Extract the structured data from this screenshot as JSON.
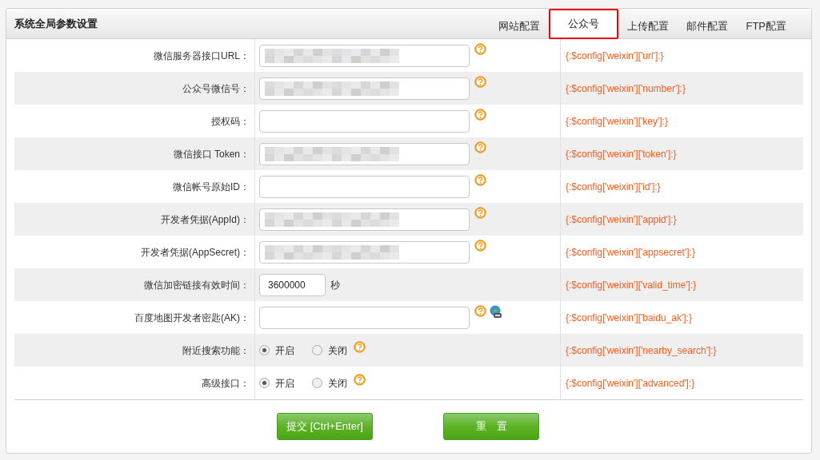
{
  "panel": {
    "title": "系统全局参数设置"
  },
  "tabs": [
    {
      "label": "网站配置",
      "selected": false
    },
    {
      "label": "公众号",
      "selected": true
    },
    {
      "label": "上传配置",
      "selected": false
    },
    {
      "label": "邮件配置",
      "selected": false
    },
    {
      "label": "FTP配置",
      "selected": false
    }
  ],
  "rows": [
    {
      "kind": "text",
      "label": "微信服务器接口URL：",
      "redacted": true,
      "help": true,
      "code": "{:$config['weixin']['url']:}"
    },
    {
      "kind": "text",
      "label": "公众号微信号：",
      "redacted": true,
      "help": true,
      "code": "{:$config['weixin']['number']:}"
    },
    {
      "kind": "text",
      "label": "授权码：",
      "redacted": false,
      "help": true,
      "code": "{:$config['weixin']['key']:}"
    },
    {
      "kind": "text",
      "label": "微信接口 Token：",
      "redacted": true,
      "help": true,
      "code": "{:$config['weixin']['token']:}"
    },
    {
      "kind": "text",
      "label": "微信帐号原始ID：",
      "redacted": false,
      "help": true,
      "code": "{:$config['weixin']['id']:}"
    },
    {
      "kind": "text",
      "label": "开发者凭据(AppId)：",
      "redacted": true,
      "help": true,
      "code": "{:$config['weixin']['appid']:}"
    },
    {
      "kind": "text",
      "label": "开发者凭据(AppSecret)：",
      "redacted": true,
      "help": true,
      "code": "{:$config['weixin']['appsecret']:}"
    },
    {
      "kind": "short",
      "label": "微信加密链接有效时间：",
      "value": "3600000",
      "unit": "秒",
      "code": "{:$config['weixin']['valid_time']:}"
    },
    {
      "kind": "text",
      "label": "百度地图开发者密匙(AK)：",
      "redacted": false,
      "help": true,
      "map_link": true,
      "code": "{:$config['weixin']['baidu_ak']:}"
    },
    {
      "kind": "radio",
      "label": "附近搜索功能：",
      "options": [
        {
          "label": "开启",
          "selected": true
        },
        {
          "label": "关闭",
          "selected": false
        }
      ],
      "help": true,
      "code": "{:$config['weixin']['nearby_search']:}"
    },
    {
      "kind": "radio",
      "label": "高级接口：",
      "options": [
        {
          "label": "开启",
          "selected": true
        },
        {
          "label": "关闭",
          "selected": false
        }
      ],
      "help": true,
      "code": "{:$config['weixin']['advanced']:}"
    }
  ],
  "buttons": [
    "提交 [Ctrl+Enter]",
    "重　置"
  ]
}
